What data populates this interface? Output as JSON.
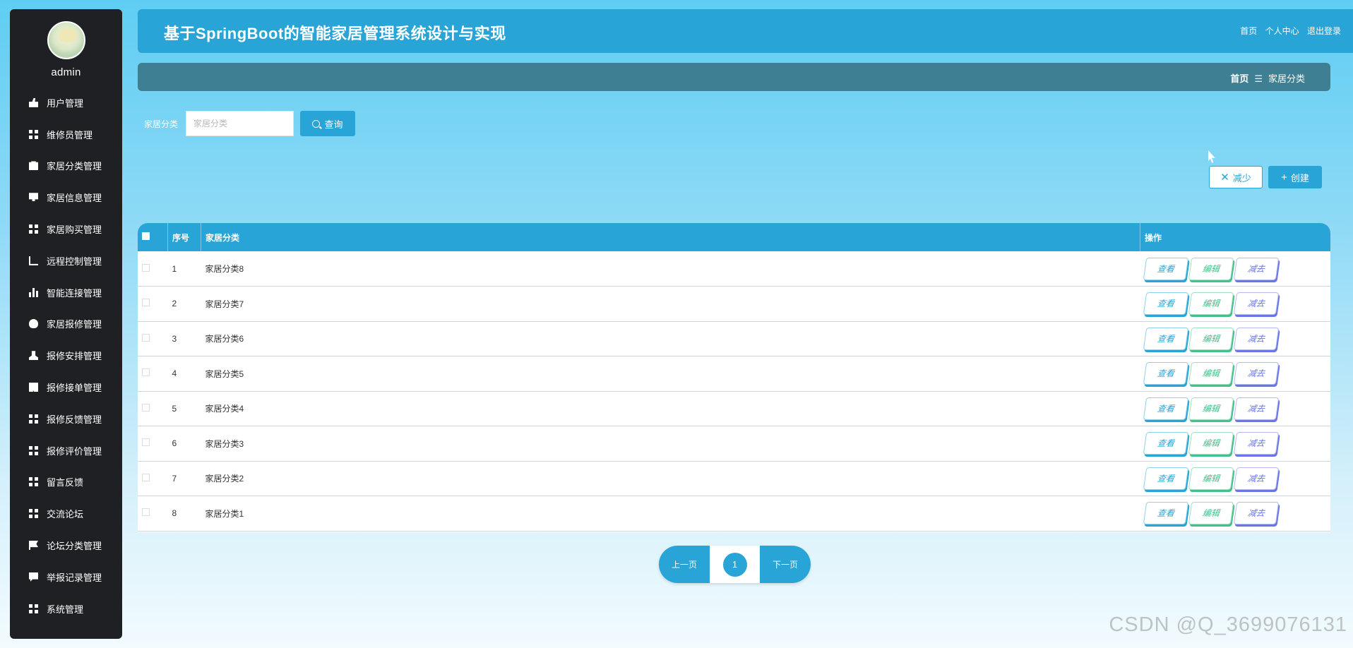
{
  "sidebar": {
    "username": "admin",
    "items": [
      {
        "label": "用户管理",
        "icon": "thumbs-up-icon"
      },
      {
        "label": "维修员管理",
        "icon": "grid-icon"
      },
      {
        "label": "家居分类管理",
        "icon": "clipboard-icon"
      },
      {
        "label": "家居信息管理",
        "icon": "monitor-icon"
      },
      {
        "label": "家居购买管理",
        "icon": "grid-icon"
      },
      {
        "label": "远程控制管理",
        "icon": "line-chart-icon"
      },
      {
        "label": "智能连接管理",
        "icon": "bar-chart-icon"
      },
      {
        "label": "家居报修管理",
        "icon": "bulb-icon"
      },
      {
        "label": "报修安排管理",
        "icon": "user-icon"
      },
      {
        "label": "报修接单管理",
        "icon": "book-icon"
      },
      {
        "label": "报修反馈管理",
        "icon": "grid-icon"
      },
      {
        "label": "报修评价管理",
        "icon": "grid-icon"
      },
      {
        "label": "留言反馈",
        "icon": "grid-icon"
      },
      {
        "label": "交流论坛",
        "icon": "grid-icon"
      },
      {
        "label": "论坛分类管理",
        "icon": "flag-icon"
      },
      {
        "label": "举报记录管理",
        "icon": "chat-icon"
      },
      {
        "label": "系统管理",
        "icon": "grid-icon"
      }
    ]
  },
  "header": {
    "title": "基于SpringBoot的智能家居管理系统设计与实现",
    "links": {
      "home": "首页",
      "profile": "个人中心",
      "logout": "退出登录"
    }
  },
  "breadcrumb": {
    "home": "首页",
    "separator": "☰",
    "current": "家居分类"
  },
  "search": {
    "label": "家居分类",
    "placeholder": "家居分类",
    "value": "",
    "button": "查询"
  },
  "actions": {
    "reduce": "减少",
    "create": "创建"
  },
  "table": {
    "columns": {
      "index": "序号",
      "category": "家居分类",
      "ops": "操作"
    },
    "rows": [
      {
        "index": "1",
        "category": "家居分类8"
      },
      {
        "index": "2",
        "category": "家居分类7"
      },
      {
        "index": "3",
        "category": "家居分类6"
      },
      {
        "index": "4",
        "category": "家居分类5"
      },
      {
        "index": "5",
        "category": "家居分类4"
      },
      {
        "index": "6",
        "category": "家居分类3"
      },
      {
        "index": "7",
        "category": "家居分类2"
      },
      {
        "index": "8",
        "category": "家居分类1"
      }
    ],
    "row_buttons": {
      "view": "查看",
      "edit": "编辑",
      "delete": "减去"
    }
  },
  "pagination": {
    "prev": "上一页",
    "current": "1",
    "next": "下一页"
  },
  "watermark": "CSDN @Q_3699076131",
  "colors": {
    "primary": "#29a4d6",
    "sidebar": "#1f2024",
    "breadcrumb_bar": "#3f7f93",
    "edit": "#45c08a",
    "delete": "#6a76e8"
  }
}
